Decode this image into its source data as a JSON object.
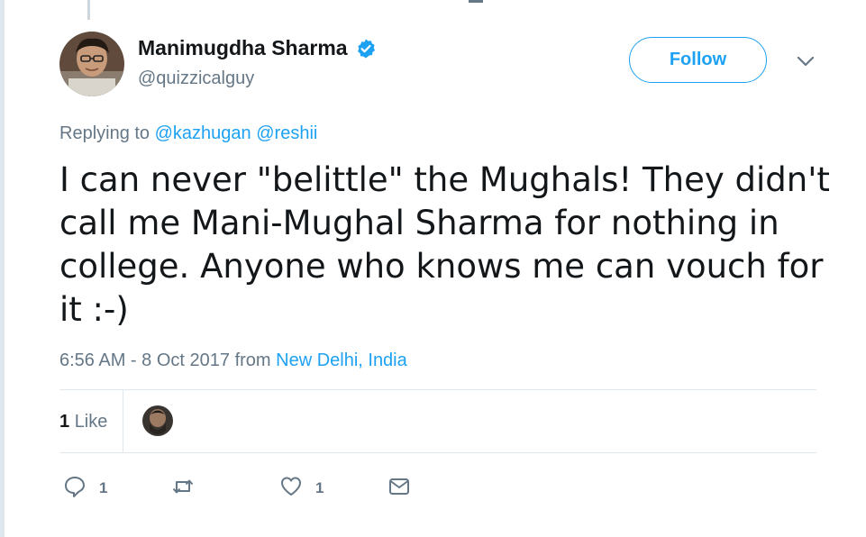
{
  "tweet": {
    "author": {
      "display_name": "Manimugdha Sharma",
      "handle": "@quizzicalguy",
      "verified": true
    },
    "follow_label": "Follow",
    "replying": {
      "prefix": "Replying to",
      "mentions": [
        "@kazhugan",
        "@reshii"
      ]
    },
    "text": "I can never \"belittle\" the Mughals! They didn't call me Mani-Mughal Sharma for nothing in college. Anyone who knows me can vouch for it :-)",
    "timestamp": "6:56 AM - 8 Oct 2017",
    "from_word": "from",
    "location": "New Delhi, India",
    "stats": {
      "likes_count": "1",
      "likes_label": "Like"
    },
    "actions": {
      "reply_count": "1",
      "retweet_count": "",
      "like_count": "1"
    }
  },
  "colors": {
    "accent": "#1da1f2",
    "muted": "#657786",
    "text": "#14171a",
    "divider": "#e1e8ed"
  },
  "icons": [
    "verified-badge-icon",
    "chevron-down-icon",
    "reply-icon",
    "retweet-icon",
    "heart-icon",
    "message-icon"
  ]
}
